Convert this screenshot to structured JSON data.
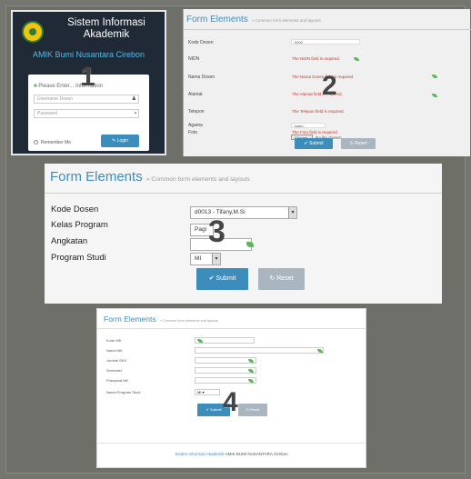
{
  "panel1": {
    "title_line1": "Sistem Informasi",
    "title_line2": "Akademik",
    "campus": "AMIK Bumi Nusantara Cirebon",
    "login_header": "Please Enter... Information",
    "username_placeholder": "Username Dosen",
    "password_placeholder": "Password",
    "remember_label": "Remember Me",
    "login_button": "Login",
    "number": "1"
  },
  "panel2": {
    "title": "Form Elements",
    "subtitle": "Common form elements and layouts",
    "kode_label": "Kode Dosen",
    "kode_value": "0000",
    "nidn_label": "NIDN",
    "nidn_error": "The NIDN field is required.",
    "nama_label": "Nama Dosen",
    "nama_error": "The Nama Dosen field is required.",
    "alamat_label": "Alamat",
    "alamat_error": "The Alamat field is required.",
    "telepon_label": "Telepon",
    "telepon_error": "The Telepon field is required.",
    "agama_label": "Agama",
    "agama_value": "Islam",
    "foto_label": "Foto",
    "foto_error": "The Foto field is required.",
    "choose_file": "Choose File",
    "no_file": "No file chosen",
    "submit": "Submit",
    "reset": "Reset",
    "number": "2"
  },
  "panel3": {
    "title": "Form Elements",
    "subtitle": "Common form elements and layouts",
    "kode_label": "Kode Dosen",
    "kode_value": "d0013 - Tifany,M.Si",
    "kelas_label": "Kelas Program",
    "kelas_value": "Pagi",
    "angkatan_label": "Angkatan",
    "prodi_label": "Program Studi",
    "prodi_value": "MI",
    "submit": "Submit",
    "reset": "Reset",
    "number": "3"
  },
  "panel4": {
    "title": "Form Elements",
    "subtitle": "Common form elements and layouts",
    "labels": [
      "Kode MK",
      "Nama MK",
      "Jumlah SKS",
      "Semester",
      "Prasyarat MK",
      "Nama Program Studi"
    ],
    "prodi_value": "MI",
    "submit": "Submit",
    "reset": "Reset",
    "footer_brand": "Sistem Informasi Akademik",
    "footer_rest": "AMIK BUMI NUSANTARA Cirebon",
    "number": "4"
  },
  "colors": {
    "primary": "#3c8dbc",
    "error": "#c0392b",
    "leaf": "#5cb85c",
    "login_bg": "#1f2a36"
  }
}
